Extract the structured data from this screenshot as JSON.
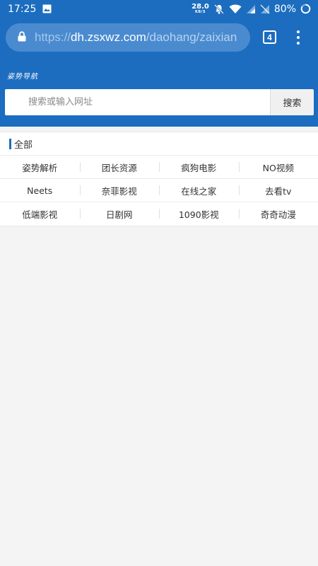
{
  "status_bar": {
    "time": "17:25",
    "net_speed": "28.0",
    "net_unit": "KB/S",
    "battery": "80%"
  },
  "browser": {
    "url_scheme": "https://",
    "url_host": "dh.zsxwz.com",
    "url_path": "/daohang/zaixian",
    "tab_count": "4",
    "icons": [
      "image-icon",
      "mute-icon",
      "wifi-icon",
      "signal-icon",
      "battery-icon",
      "lock-icon",
      "menu-icon"
    ]
  },
  "header": {
    "site_title": "姿势导航",
    "search_placeholder": "搜索或输入网址",
    "search_button": "搜索"
  },
  "section": {
    "title": "全部",
    "rows": [
      [
        "姿势解析",
        "团长资源",
        "疯狗电影",
        "NO视频"
      ],
      [
        "Neets",
        "奈菲影视",
        "在线之家",
        "去看tv"
      ],
      [
        "低端影视",
        "日剧网",
        "1090影视",
        "奇奇动漫"
      ]
    ]
  },
  "colors": {
    "primary": "#1c6dbf",
    "url_box": "#4a8bd0",
    "page_bg": "#f4f4f4"
  }
}
